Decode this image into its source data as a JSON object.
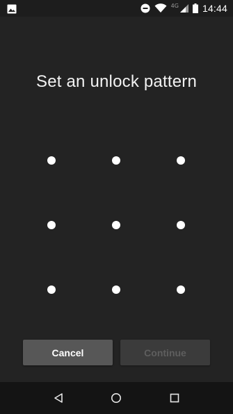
{
  "status_bar": {
    "time": "14:44",
    "network_type": "4G",
    "icons": [
      "image-notification-icon",
      "do-not-disturb-icon",
      "wifi-icon",
      "cell-signal-icon",
      "battery-icon"
    ]
  },
  "screen": {
    "title": "Set an unlock pattern"
  },
  "pattern_grid": {
    "rows": 3,
    "columns": 3,
    "dot_color": "#ffffff"
  },
  "buttons": {
    "cancel_label": "Cancel",
    "continue_label": "Continue",
    "continue_enabled": false
  },
  "nav_bar": {
    "icons": [
      "back-icon",
      "home-icon",
      "recents-icon"
    ]
  },
  "colors": {
    "background": "#232323",
    "cancel_button": "#575757",
    "continue_button_disabled": "#3b3b3b",
    "nav_bar": "#141414"
  }
}
